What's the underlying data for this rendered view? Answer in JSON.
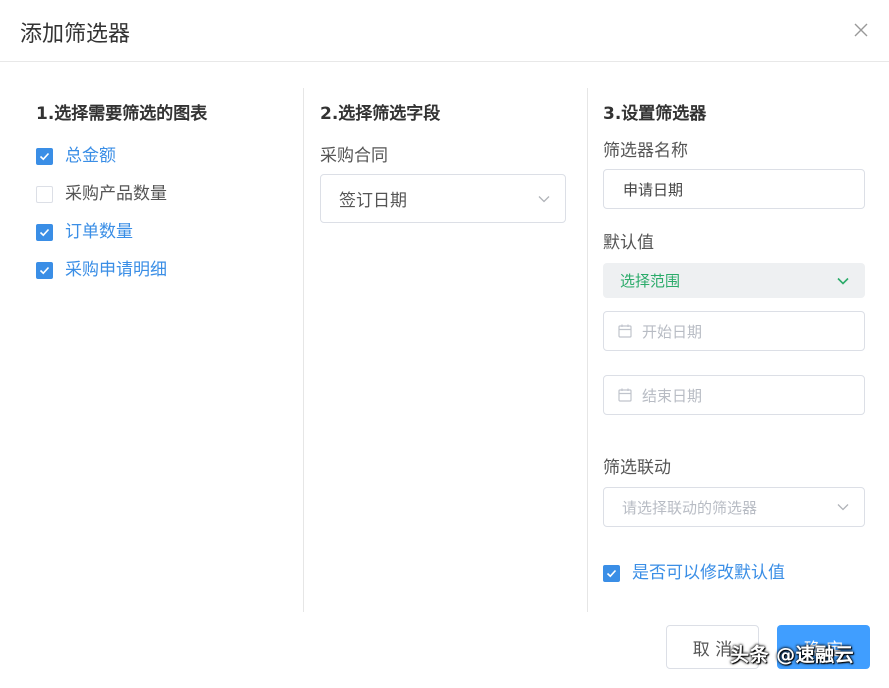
{
  "dialog": {
    "title": "添加筛选器"
  },
  "step1": {
    "title": "1.选择需要筛选的图表",
    "items": [
      {
        "label": "总金额",
        "checked": true
      },
      {
        "label": "采购产品数量",
        "checked": false
      },
      {
        "label": "订单数量",
        "checked": true
      },
      {
        "label": "采购申请明细",
        "checked": true
      }
    ]
  },
  "step2": {
    "title": "2.选择筛选字段",
    "source_label": "采购合同",
    "field_value": "签订日期"
  },
  "step3": {
    "title": "3.设置筛选器",
    "name_label": "筛选器名称",
    "name_value": "申请日期",
    "default_label": "默认值",
    "range_value": "选择范围",
    "start_placeholder": "开始日期",
    "end_placeholder": "结束日期",
    "linkage_label": "筛选联动",
    "linkage_placeholder": "请选择联动的筛选器",
    "modifiable_label": "是否可以修改默认值",
    "modifiable_checked": true
  },
  "footer": {
    "cancel_label": "取 消",
    "ok_label": "确 定"
  },
  "watermark": "头条 @速融云",
  "colors": {
    "accent": "#409eff",
    "checked": "#3a8ee6",
    "range_text": "#2bab6a"
  }
}
